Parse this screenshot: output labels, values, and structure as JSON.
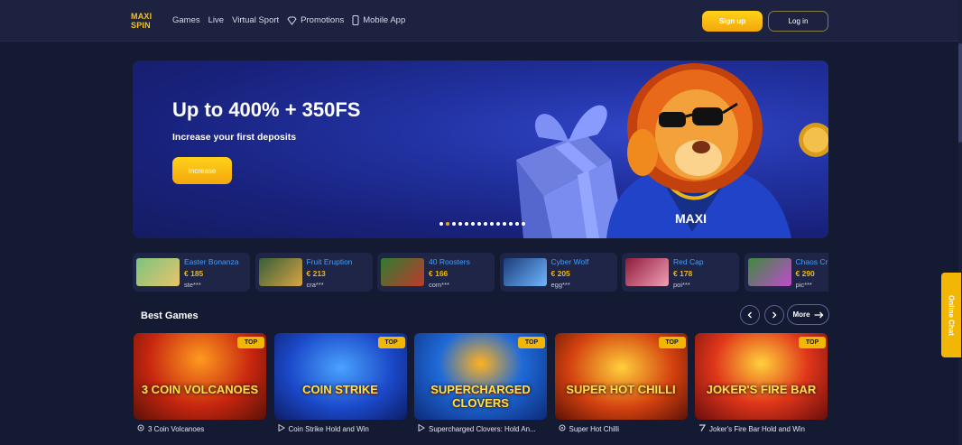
{
  "header": {
    "logo_line1": "MAXI",
    "logo_line2": "SPIN",
    "nav": [
      {
        "label": "Games",
        "icon": ""
      },
      {
        "label": "Live",
        "icon": ""
      },
      {
        "label": "Virtual Sport",
        "icon": ""
      },
      {
        "label": "Promotions",
        "icon": "diamond-icon"
      },
      {
        "label": "Mobile App",
        "icon": "phone-icon"
      }
    ],
    "signup_label": "Sign up",
    "login_label": "Log in"
  },
  "banner": {
    "title": "Up to 400% + 350FS",
    "subtitle": "Increase your first deposits",
    "button_label": "Increase",
    "lion_badge": "MAXI",
    "slide_count": 14,
    "active_slide": 1
  },
  "winners": [
    {
      "game": "Easter Bonanza",
      "amount": "€ 185",
      "user": "ste***"
    },
    {
      "game": "Fruit Eruption",
      "amount": "€ 213",
      "user": "cra***"
    },
    {
      "game": "40 Roosters",
      "amount": "€ 166",
      "user": "com***"
    },
    {
      "game": "Cyber Wolf",
      "amount": "€ 205",
      "user": "egg***"
    },
    {
      "game": "Red Cap",
      "amount": "€ 178",
      "user": "poi***"
    },
    {
      "game": "Chaos Cr",
      "amount": "€ 290",
      "user": "pic***"
    }
  ],
  "best_games": {
    "title": "Best Games",
    "more_label": "More",
    "badge": "TOP",
    "items": [
      {
        "name": "3 Coin Volcanoes",
        "tile_text": "3 COIN VOLCANOES",
        "provider_icon": "spiral-provider-icon"
      },
      {
        "name": "Coin Strike Hold and Win",
        "tile_text": "COIN STRIKE",
        "provider_icon": "play-provider-icon"
      },
      {
        "name": "Supercharged Clovers: Hold An...",
        "tile_text": "SUPERCHARGED CLOVERS",
        "provider_icon": "play-provider-icon"
      },
      {
        "name": "Super Hot Chilli",
        "tile_text": "SUPER HOT CHILLI",
        "provider_icon": "spiral-provider-icon"
      },
      {
        "name": "Joker's Fire Bar Hold and Win",
        "tile_text": "JOKER'S FIRE BAR",
        "provider_icon": "seven-provider-icon"
      }
    ]
  },
  "chat": {
    "label": "Online Chat"
  },
  "colors": {
    "accent": "#f2b705",
    "background": "#151a33",
    "link": "#3fa0ff"
  }
}
